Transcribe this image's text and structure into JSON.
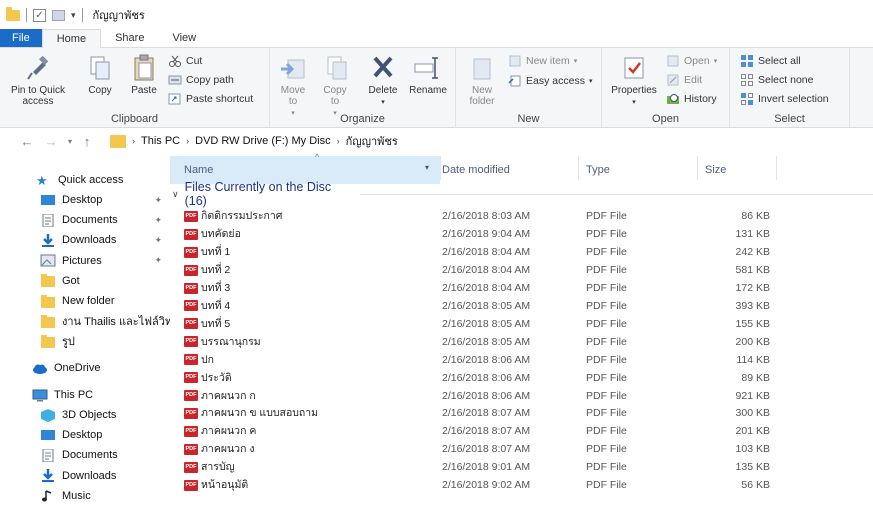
{
  "window": {
    "title": "กัญญาพัชร"
  },
  "ribbon_tabs": [
    "File",
    "Home",
    "Share",
    "View"
  ],
  "ribbon": {
    "clipboard": {
      "label": "Clipboard",
      "pin_to_quick_access": "Pin to Quick access",
      "copy": "Copy",
      "paste": "Paste",
      "cut": "Cut",
      "copy_path": "Copy path",
      "paste_shortcut": "Paste shortcut"
    },
    "organize": {
      "label": "Organize",
      "move_to": "Move to",
      "copy_to": "Copy to",
      "delete": "Delete",
      "rename": "Rename"
    },
    "new": {
      "label": "New",
      "new_folder": "New folder",
      "new_item": "New item",
      "easy_access": "Easy access"
    },
    "open": {
      "label": "Open",
      "properties": "Properties",
      "open": "Open",
      "edit": "Edit",
      "history": "History"
    },
    "select": {
      "label": "Select",
      "select_all": "Select all",
      "select_none": "Select none",
      "invert_selection": "Invert selection"
    }
  },
  "address": {
    "crumbs": [
      "This PC",
      "DVD RW Drive (F:) My Disc",
      "กัญญาพัชร"
    ]
  },
  "nav": {
    "quick_access": "Quick access",
    "qa_items": [
      "Desktop",
      "Documents",
      "Downloads",
      "Pictures",
      "Got",
      "New folder",
      "งาน Thailis และไฟล์วิท",
      "รูป"
    ],
    "onedrive": "OneDrive",
    "this_pc": "This PC",
    "pc_items": [
      "3D Objects",
      "Desktop",
      "Documents",
      "Downloads",
      "Music"
    ]
  },
  "columns": {
    "name": "Name",
    "date": "Date modified",
    "type": "Type",
    "size": "Size"
  },
  "group_header": "Files Currently on the Disc (16)",
  "files": [
    {
      "name": "กิตติกรรมประกาศ",
      "date": "2/16/2018 8:03 AM",
      "type": "PDF File",
      "size": "86 KB"
    },
    {
      "name": "บทคัดย่อ",
      "date": "2/16/2018 9:04 AM",
      "type": "PDF File",
      "size": "131 KB"
    },
    {
      "name": "บทที่ 1",
      "date": "2/16/2018 8:04 AM",
      "type": "PDF File",
      "size": "242 KB"
    },
    {
      "name": "บทที่ 2",
      "date": "2/16/2018 8:04 AM",
      "type": "PDF File",
      "size": "581 KB"
    },
    {
      "name": "บทที่ 3",
      "date": "2/16/2018 8:04 AM",
      "type": "PDF File",
      "size": "172 KB"
    },
    {
      "name": "บทที่ 4",
      "date": "2/16/2018 8:05 AM",
      "type": "PDF File",
      "size": "393 KB"
    },
    {
      "name": "บทที่ 5",
      "date": "2/16/2018 8:05 AM",
      "type": "PDF File",
      "size": "155 KB"
    },
    {
      "name": "บรรณานุกรม",
      "date": "2/16/2018 8:05 AM",
      "type": "PDF File",
      "size": "200 KB"
    },
    {
      "name": "ปก",
      "date": "2/16/2018 8:06 AM",
      "type": "PDF File",
      "size": "114 KB"
    },
    {
      "name": "ประวัติ",
      "date": "2/16/2018 8:06 AM",
      "type": "PDF File",
      "size": "89 KB"
    },
    {
      "name": "ภาคผนวก ก",
      "date": "2/16/2018 8:06 AM",
      "type": "PDF File",
      "size": "921 KB"
    },
    {
      "name": "ภาคผนวก ข แบบสอบถาม",
      "date": "2/16/2018 8:07 AM",
      "type": "PDF File",
      "size": "300 KB"
    },
    {
      "name": "ภาคผนวก ค",
      "date": "2/16/2018 8:07 AM",
      "type": "PDF File",
      "size": "201 KB"
    },
    {
      "name": "ภาคผนวก ง",
      "date": "2/16/2018 8:07 AM",
      "type": "PDF File",
      "size": "103 KB"
    },
    {
      "name": "สารบัญ",
      "date": "2/16/2018 9:01 AM",
      "type": "PDF File",
      "size": "135 KB"
    },
    {
      "name": "หน้าอนุมัติ",
      "date": "2/16/2018 9:02 AM",
      "type": "PDF File",
      "size": "56 KB"
    }
  ],
  "icons": {
    "file_type": "pdf-icon",
    "pdf_badge": "PDF",
    "pdf_color": "#c9262b",
    "folder_color": "#f4c84e",
    "accent": "#1a6cc8"
  }
}
